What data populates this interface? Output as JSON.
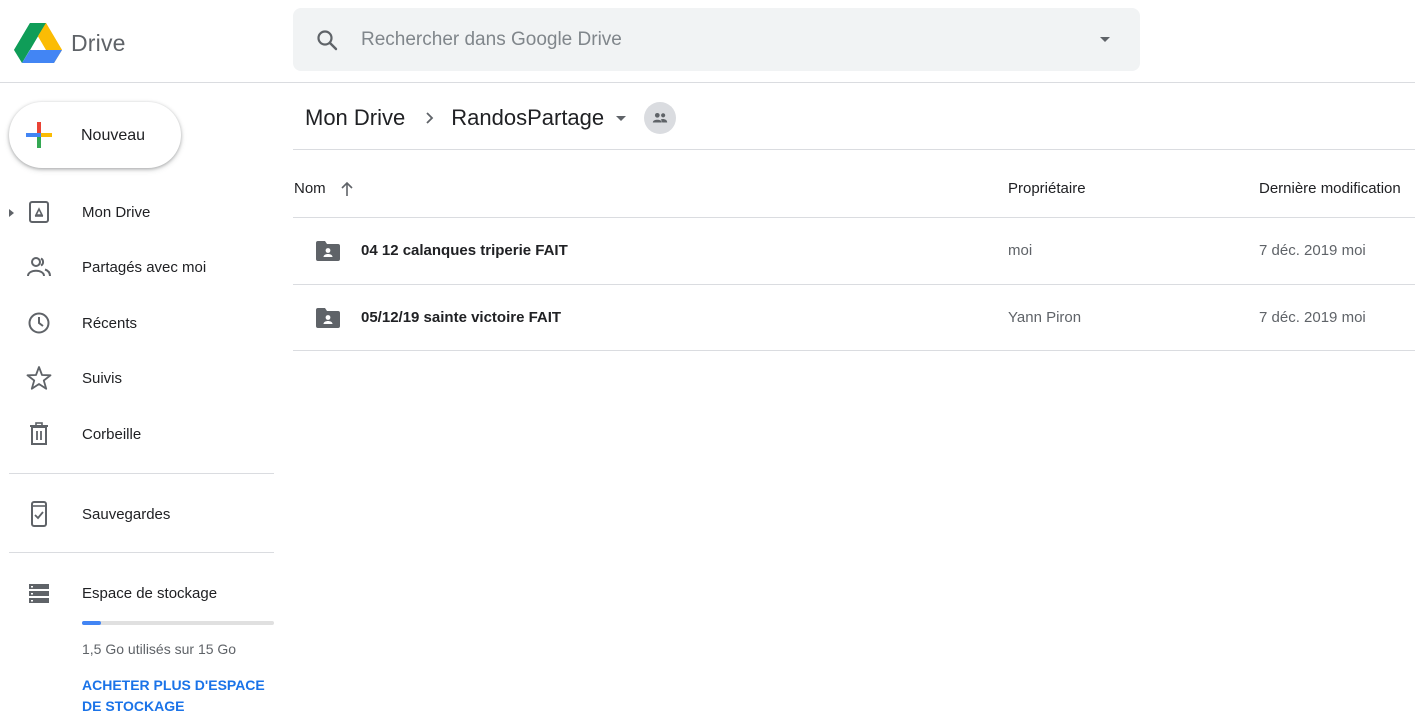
{
  "app": {
    "logo_text": "Drive"
  },
  "search": {
    "placeholder": "Rechercher dans Google Drive"
  },
  "sidebar": {
    "new_label": "Nouveau",
    "items": [
      {
        "label": "Mon Drive",
        "icon": "drive-icon"
      },
      {
        "label": "Partagés avec moi",
        "icon": "shared-people-icon"
      },
      {
        "label": "Récents",
        "icon": "clock-icon"
      },
      {
        "label": "Suivis",
        "icon": "star-icon"
      },
      {
        "label": "Corbeille",
        "icon": "trash-icon"
      },
      {
        "label": "Sauvegardes",
        "icon": "backup-phone-icon"
      },
      {
        "label": "Espace de stockage",
        "icon": "storage-icon"
      }
    ],
    "storage": {
      "used_text": "1,5 Go utilisés sur 15 Go",
      "used_fraction": 0.1,
      "buy_label": "ACHETER PLUS D'ESPACE DE STOCKAGE"
    }
  },
  "breadcrumb": {
    "root": "Mon Drive",
    "current": "RandosPartage"
  },
  "table": {
    "columns": {
      "name": "Nom",
      "owner": "Propriétaire",
      "modified": "Dernière modification"
    },
    "rows": [
      {
        "name": "04 12 calanques triperie FAIT",
        "owner": "moi",
        "date": "7 déc. 2019",
        "modified_by": "moi"
      },
      {
        "name": "05/12/19 sainte victoire FAIT",
        "owner": "Yann Piron",
        "date": "7 déc. 2019",
        "modified_by": "moi"
      }
    ]
  },
  "colors": {
    "accent_blue": "#1a73e8",
    "storage_blue": "#4285f4",
    "icon_gray": "#5f6368"
  }
}
